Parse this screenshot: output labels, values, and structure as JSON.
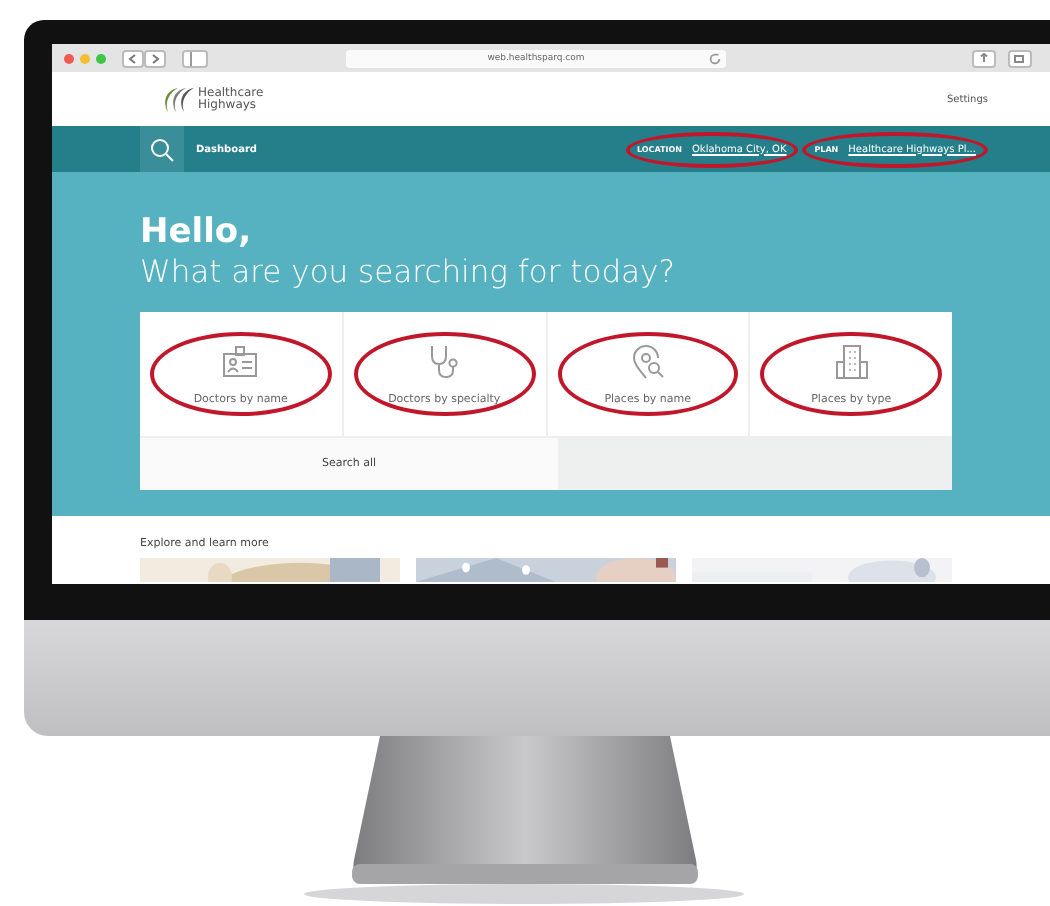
{
  "browser": {
    "url": "web.healthsparq.com"
  },
  "header": {
    "logo": [
      "Healthcare",
      "Highways"
    ],
    "settings": "Settings"
  },
  "nav": {
    "dashboard": "Dashboard",
    "filters": [
      {
        "label": "LOCATION",
        "value": "Oklahoma City, OK",
        "highlighted": true
      },
      {
        "label": "PLAN",
        "value": "Healthcare Highways Pl...",
        "highlighted": true
      }
    ]
  },
  "hero": {
    "greeting": "Hello,",
    "question": "What are you searching for today?"
  },
  "cards": [
    {
      "kind": "badge",
      "label": "Doctors by name",
      "highlighted": true
    },
    {
      "kind": "stethoscope",
      "label": "Doctors by specialty",
      "highlighted": true
    },
    {
      "kind": "pin",
      "label": "Places by name",
      "highlighted": true
    },
    {
      "kind": "building",
      "label": "Places by type",
      "highlighted": true
    }
  ],
  "search_all": "Search all",
  "explore": {
    "title": "Explore and learn more"
  }
}
